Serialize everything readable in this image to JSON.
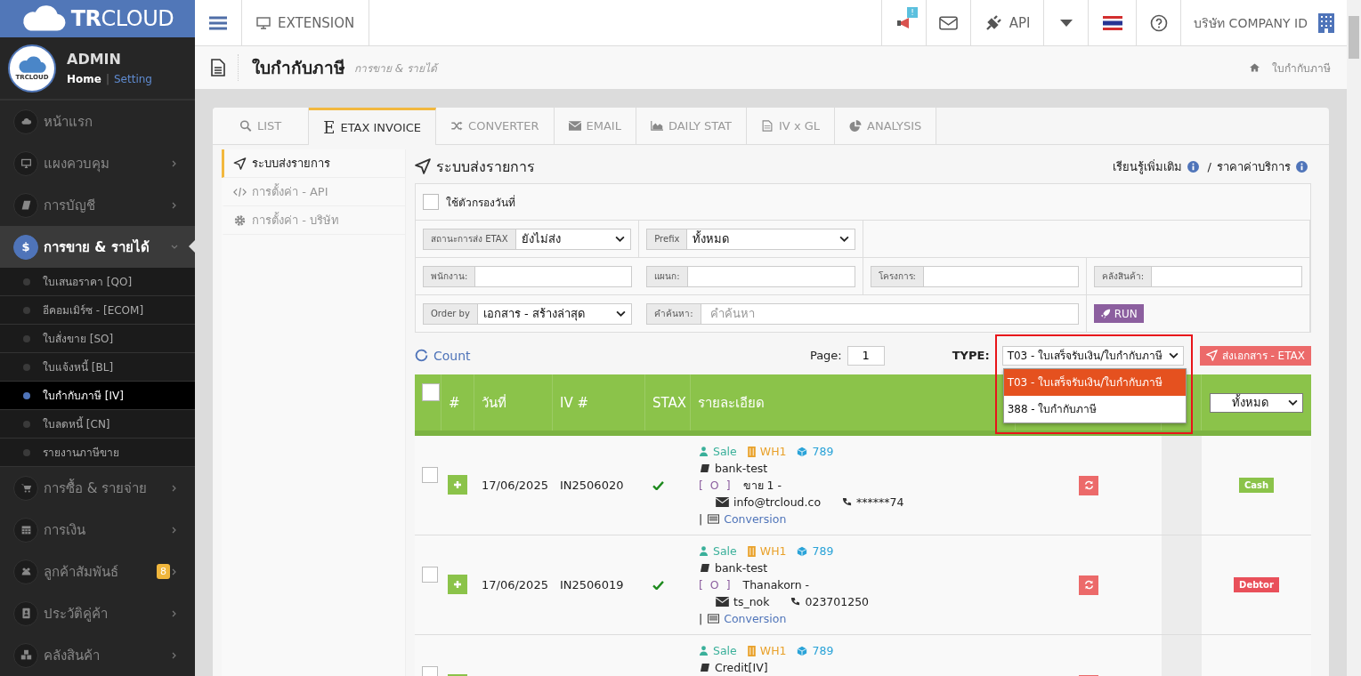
{
  "brand": {
    "name": "**TR**CLOUD",
    "avatar_text": "TRCLOUD"
  },
  "user": {
    "name": "ADMIN",
    "separator": "|",
    "links": [
      {
        "label": "Home",
        "selected": true
      },
      {
        "label": "Setting",
        "selected": false
      }
    ]
  },
  "sidebar": {
    "items": [
      {
        "label": "หน้าแรก",
        "kind": "link",
        "selected": false
      },
      {
        "label": "แผงควบคุม",
        "kind": "group",
        "selected": false,
        "expanded": false
      },
      {
        "label": "การบัญชี",
        "kind": "group",
        "selected": false,
        "expanded": false
      },
      {
        "label": "การขาย & รายได้",
        "kind": "group",
        "symbol": "$",
        "selected": true,
        "expanded": true,
        "children": [
          {
            "label": "ใบเสนอราคา [QO]",
            "selected": false
          },
          {
            "label": "อีคอมเมิร์ซ - [ECOM]",
            "selected": false
          },
          {
            "label": "ใบสั่งขาย [SO]",
            "selected": false
          },
          {
            "label": "ใบแจ้งหนี้ [BL]",
            "selected": false
          },
          {
            "label": "ใบกำกับภาษี [IV]",
            "selected": true
          },
          {
            "label": "ใบลดหนี้ [CN]",
            "selected": false
          },
          {
            "label": "รายงานภาษีขาย",
            "selected": false
          }
        ]
      },
      {
        "label": "การซื้อ & รายจ่าย",
        "kind": "group",
        "selected": false,
        "expanded": false
      },
      {
        "label": "การเงิน",
        "kind": "group",
        "selected": false,
        "expanded": false
      },
      {
        "label": "ลูกค้าสัมพันธ์",
        "kind": "group",
        "badge": "8",
        "selected": false,
        "expanded": false
      },
      {
        "label": "ประวัติคู่ค้า",
        "kind": "group",
        "selected": false,
        "expanded": false
      },
      {
        "label": "คลังสินค้า",
        "kind": "group",
        "selected": false,
        "expanded": false
      }
    ]
  },
  "topbar": {
    "extension": "EXTENSION",
    "notice_badge": "!",
    "api": "API",
    "company": "บริษัท COMPANY ID"
  },
  "page_header": {
    "title": "ใบกำกับภาษี",
    "subtitle": "การขาย & รายได้",
    "breadcrumb": "ใบกำกับภาษี"
  },
  "tabs": [
    {
      "label": "LIST",
      "selected": false
    },
    {
      "label": "ETAX INVOICE",
      "symbol": "E",
      "selected": true
    },
    {
      "label": "CONVERTER",
      "selected": false
    },
    {
      "label": "EMAIL",
      "selected": false
    },
    {
      "label": "DAILY STAT",
      "selected": false
    },
    {
      "label": "IV x GL",
      "selected": false
    },
    {
      "label": "ANALYSIS",
      "selected": false
    }
  ],
  "subnav": [
    {
      "label": "ระบบส่งรายการ",
      "selected": true
    },
    {
      "label": "การตั้งค่า - API",
      "selected": false
    },
    {
      "label": "การตั้งค่า - บริษัท",
      "selected": false
    }
  ],
  "panel": {
    "title": "ระบบส่งรายการ",
    "learn_more": "เรียนรู้เพิ่มเติม",
    "separator": "/",
    "pricing": "ราคาค่าบริการ"
  },
  "filters": {
    "date_filter": {
      "label": "ใช้ตัวกรองวันที่",
      "checked": false
    },
    "etax_status": {
      "label": "สถานะการส่ง ETAX",
      "value": "ยังไม่ส่ง"
    },
    "prefix": {
      "label": "Prefix",
      "value": "ทั้งหมด"
    },
    "employee": {
      "label": "พนักงาน:"
    },
    "department": {
      "label": "แผนก:"
    },
    "project": {
      "label": "โครงการ:"
    },
    "warehouse": {
      "label": "คลังสินค้า:"
    },
    "order_by": {
      "label": "Order by",
      "value": "เอกสาร - สร้างล่าสุด"
    },
    "search": {
      "label": "คำค้นหา:",
      "placeholder": "คำค้นหา"
    },
    "run": "RUN"
  },
  "toolbar": {
    "count": "Count",
    "page_label": "Page:",
    "page": "1",
    "type_label": "TYPE:",
    "type_value": "T03 - ใบเสร็จรับเงิน/ใบกำกับภาษี",
    "send": "ส่งเอกสาร - ETAX",
    "type_options": [
      {
        "label": "T03 - ใบเสร็จรับเงิน/ใบกำกับภาษี",
        "selected": true
      },
      {
        "label": "388 - ใบกำกับภาษี",
        "selected": false
      }
    ]
  },
  "table": {
    "columns": [
      "#",
      "วันที่",
      "IV #",
      "STAX",
      "รายละเอียด"
    ],
    "status_filter": "ทั้งหมด",
    "all_checked": false,
    "rows": [
      {
        "checked": false,
        "date": "17/06/2025",
        "iv": "IN2506020",
        "stax": true,
        "sale": "Sale",
        "warehouse": "WH1",
        "project": "789",
        "account": "bank-test",
        "code": "[ O ]",
        "customer": "ขาย 1 -",
        "email": "info@trcloud.co",
        "phone": "******74",
        "link_prefix": "|",
        "link": "Conversion",
        "badge": "Cash",
        "color": "#8bc34a"
      },
      {
        "checked": false,
        "date": "17/06/2025",
        "iv": "IN2506019",
        "stax": true,
        "sale": "Sale",
        "warehouse": "WH1",
        "project": "789",
        "account": "bank-test",
        "code": "[ O ]",
        "customer": "Thanakorn -",
        "email": "ts_nok",
        "phone": "023701250",
        "link_prefix": "|",
        "link": "Conversion",
        "badge": "Debtor",
        "color": "#e9505a"
      },
      {
        "checked": false,
        "sale": "Sale",
        "warehouse": "WH1",
        "project": "789",
        "account": "Credit[IV]"
      }
    ]
  }
}
